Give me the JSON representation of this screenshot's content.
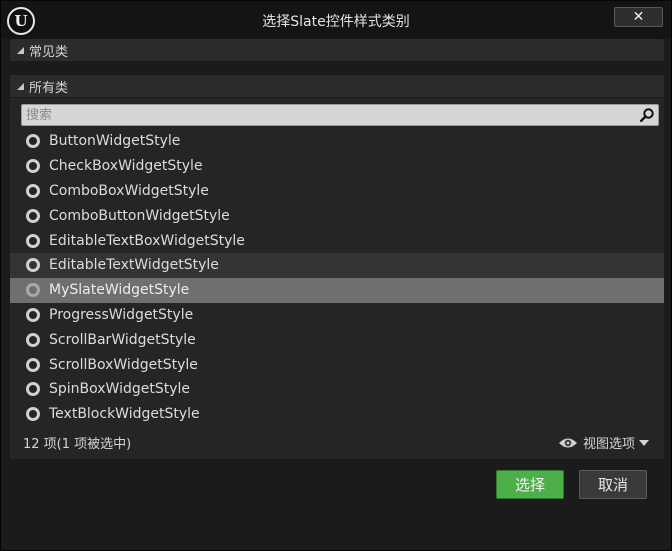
{
  "window": {
    "title": "选择Slate控件样式类别",
    "logo_text": "U",
    "close_glyph": "✕"
  },
  "sections": {
    "common": "常见类",
    "all": "所有类"
  },
  "search": {
    "placeholder": "搜索",
    "value": ""
  },
  "list": {
    "items": [
      {
        "label": "ButtonWidgetStyle",
        "state": "normal"
      },
      {
        "label": "CheckBoxWidgetStyle",
        "state": "normal"
      },
      {
        "label": "ComboBoxWidgetStyle",
        "state": "normal"
      },
      {
        "label": "ComboButtonWidgetStyle",
        "state": "normal"
      },
      {
        "label": "EditableTextBoxWidgetStyle",
        "state": "normal"
      },
      {
        "label": "EditableTextWidgetStyle",
        "state": "hover"
      },
      {
        "label": "MySlateWidgetStyle",
        "state": "selected"
      },
      {
        "label": "ProgressWidgetStyle",
        "state": "normal"
      },
      {
        "label": "ScrollBarWidgetStyle",
        "state": "normal"
      },
      {
        "label": "ScrollBoxWidgetStyle",
        "state": "normal"
      },
      {
        "label": "SpinBoxWidgetStyle",
        "state": "normal"
      },
      {
        "label": "TextBlockWidgetStyle",
        "state": "normal"
      }
    ]
  },
  "footer": {
    "count_text": "12 项(1 项被选中)",
    "view_options_label": "视图选项"
  },
  "buttons": {
    "select_label": "选择",
    "cancel_label": "取消"
  },
  "colors": {
    "select_button": "#4caf4a",
    "selected_row": "#6f6f6f",
    "hover_row": "#343434"
  },
  "icons": {
    "search": "search-icon",
    "eye": "eye-icon",
    "close": "close-icon",
    "radio": "radio-icon"
  }
}
